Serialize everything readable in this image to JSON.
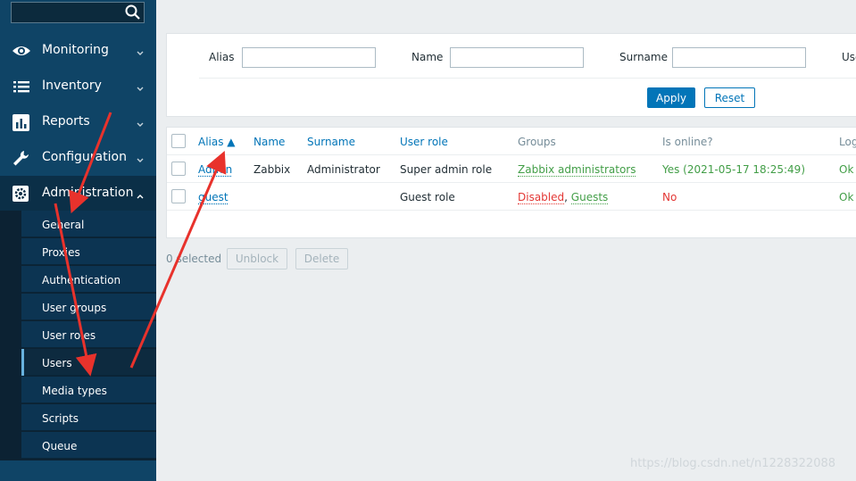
{
  "sidebar": {
    "search_placeholder": "",
    "menu": [
      {
        "label": "Monitoring",
        "icon": "eye-icon"
      },
      {
        "label": "Inventory",
        "icon": "list-icon"
      },
      {
        "label": "Reports",
        "icon": "bar-chart-icon"
      },
      {
        "label": "Configuration",
        "icon": "wrench-icon"
      },
      {
        "label": "Administration",
        "icon": "gear-icon",
        "expanded": true
      }
    ],
    "submenu": [
      {
        "label": "General"
      },
      {
        "label": "Proxies"
      },
      {
        "label": "Authentication"
      },
      {
        "label": "User groups"
      },
      {
        "label": "User roles"
      },
      {
        "label": "Users",
        "active": true
      },
      {
        "label": "Media types"
      },
      {
        "label": "Scripts"
      },
      {
        "label": "Queue"
      }
    ]
  },
  "filter": {
    "alias_label": "Alias",
    "name_label": "Name",
    "surname_label": "Surname",
    "user_role_label": "Use",
    "alias_value": "",
    "name_value": "",
    "surname_value": "",
    "apply_label": "Apply",
    "reset_label": "Reset"
  },
  "table": {
    "headers": {
      "alias": "Alias ▲",
      "name": "Name",
      "surname": "Surname",
      "user_role": "User role",
      "groups": "Groups",
      "is_online": "Is online?",
      "login": "Log"
    },
    "rows": [
      {
        "alias": "Admin",
        "name": "Zabbix",
        "surname": "Administrator",
        "user_role": "Super admin role",
        "group1": "Zabbix administrators",
        "group_sep": "",
        "group2": "",
        "is_online": "Yes (2021-05-17 18:25:49)",
        "login": "Ok"
      },
      {
        "alias": "guest",
        "name": "",
        "surname": "",
        "user_role": "Guest role",
        "group1": "Disabled",
        "group_sep": ",",
        "group2": "Guests",
        "is_online": "No",
        "login": "Ok"
      }
    ]
  },
  "footer": {
    "selected": "0 selected",
    "unblock_label": "Unblock",
    "delete_label": "Delete"
  },
  "watermark": "https://blog.csdn.net/n1228322088",
  "colors": {
    "sidebar": "#0f4466",
    "accent": "#0275b8",
    "ok_green": "#429e47",
    "error_red": "#e33734",
    "annotation_arrow": "#e8322c"
  }
}
